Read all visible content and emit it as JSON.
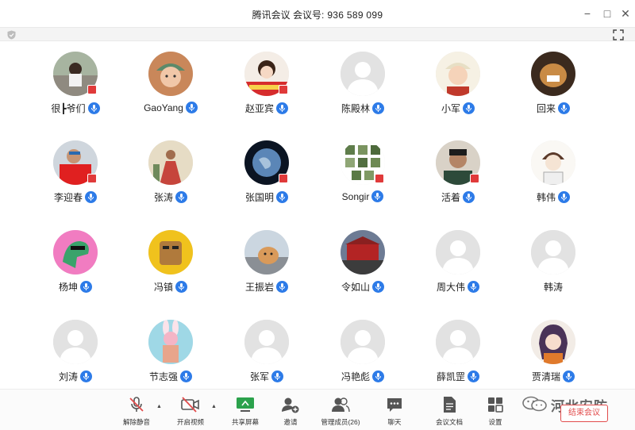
{
  "window": {
    "title_prefix": "腾讯会议 会议号:",
    "meeting_number": "936 589 099",
    "minimize_glyph": "−",
    "maximize_glyph": "□",
    "close_glyph": "✕"
  },
  "participants": [
    {
      "name": "很┣爷们",
      "mic": "unmuted",
      "avatar": "photo-group"
    },
    {
      "name": "GaoYang",
      "mic": "unmuted",
      "avatar": "cartoon-green-hat"
    },
    {
      "name": "赵亚宾",
      "mic": "unmuted",
      "avatar": "cartoon-china-flag"
    },
    {
      "name": "陈殿林",
      "mic": "unmuted",
      "avatar": "default"
    },
    {
      "name": "小军",
      "mic": "unmuted",
      "avatar": "cartoon-boy-cap"
    },
    {
      "name": "回来",
      "mic": "unmuted",
      "avatar": "photo-dog"
    },
    {
      "name": "李迎春",
      "mic": "unmuted",
      "avatar": "photo-red-shirt"
    },
    {
      "name": "张涛",
      "mic": "unmuted",
      "avatar": "painting-figure"
    },
    {
      "name": "张国明",
      "mic": "unmuted",
      "avatar": "photo-earth"
    },
    {
      "name": "Songir",
      "mic": "unmuted",
      "avatar": "photo-collage"
    },
    {
      "name": "活着",
      "mic": "unmuted",
      "avatar": "photo-man"
    },
    {
      "name": "韩伟",
      "mic": "unmuted",
      "avatar": "sketch-boy"
    },
    {
      "name": "杨坤",
      "mic": "unmuted",
      "avatar": "cartoon-dinosaur"
    },
    {
      "name": "冯镇",
      "mic": "unmuted",
      "avatar": "cartoon-bear"
    },
    {
      "name": "王振岩",
      "mic": "unmuted",
      "avatar": "photo-cat"
    },
    {
      "name": "令如山",
      "mic": "unmuted",
      "avatar": "photo-tiananmen"
    },
    {
      "name": "周大伟",
      "mic": "unmuted",
      "avatar": "default"
    },
    {
      "name": "韩涛",
      "mic": "none",
      "avatar": "default"
    },
    {
      "name": "刘涛",
      "mic": "unmuted",
      "avatar": "default"
    },
    {
      "name": "节志强",
      "mic": "unmuted",
      "avatar": "cartoon-rabbit"
    },
    {
      "name": "张军",
      "mic": "unmuted",
      "avatar": "default"
    },
    {
      "name": "冯艳彪",
      "mic": "unmuted",
      "avatar": "default"
    },
    {
      "name": "薛凯罡",
      "mic": "unmuted",
      "avatar": "default"
    },
    {
      "name": "贾清瑞",
      "mic": "unmuted",
      "avatar": "anime-girl"
    }
  ],
  "toolbar": {
    "unmute_label": "解除静音",
    "video_label": "开启视频",
    "share_label": "共享屏幕",
    "invite_label": "邀请",
    "members_label": "管理成员(26)",
    "chat_label": "聊天",
    "docs_label": "会议文档",
    "settings_label": "设置",
    "end_label": "结束会议"
  },
  "watermark": {
    "text": "河北安防"
  },
  "colors": {
    "mic_blue": "#2d7be8",
    "end_red": "#e24c4c",
    "default_avatar_bg": "#e2e2e2",
    "share_green": "#2ba24c"
  }
}
